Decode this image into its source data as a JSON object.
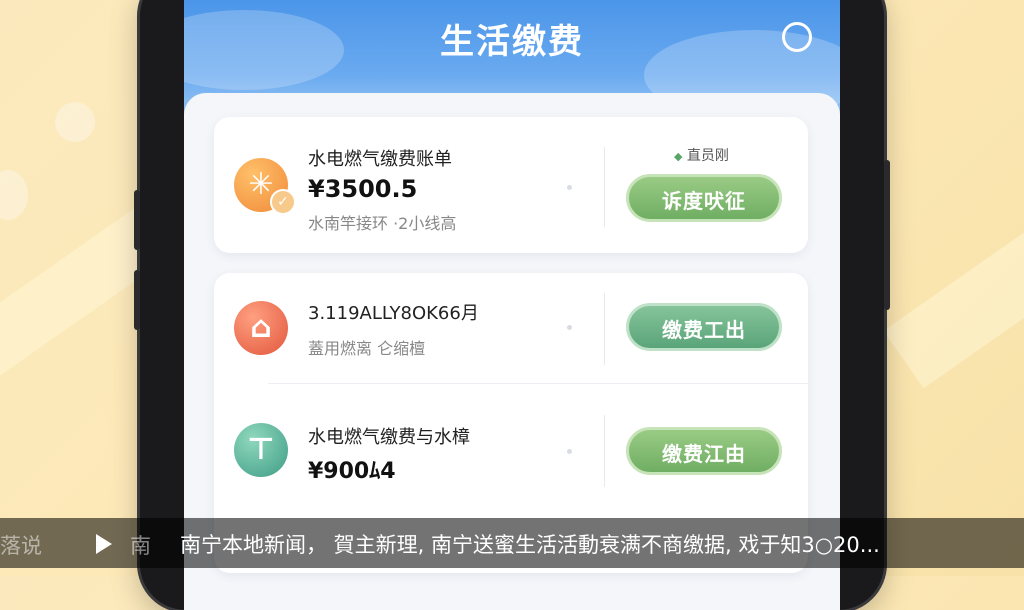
{
  "app": {
    "title": "生活缴费"
  },
  "bills": [
    {
      "title": "水电燃气缴费账单",
      "amount": "¥3500.5",
      "subtitle": "水南竿接环 ·2小线高",
      "badge": "直员刚",
      "button": "诉度吠征",
      "icon": "sun-icon",
      "color": "#f08a3a"
    },
    {
      "title": "3.119ALLY8OK66月",
      "amount": "",
      "subtitle": "蓋用燃离 仑缩檀",
      "badge": "",
      "button": "缴费工出",
      "icon": "house-icon",
      "color": "#e2573d"
    },
    {
      "title": "水电燃气缴费与水樟",
      "amount": "¥900ﾑ4",
      "subtitle": "",
      "badge": "",
      "button": "缴费江由",
      "icon": "faucet-icon",
      "color": "#3f9c85"
    }
  ],
  "caption": {
    "left": "落说",
    "mid": "南",
    "text": "南宁本地新闻， 賀主新理, 南宁送蜜生活活動衰满不商缴据, 戏于知3○20..."
  }
}
